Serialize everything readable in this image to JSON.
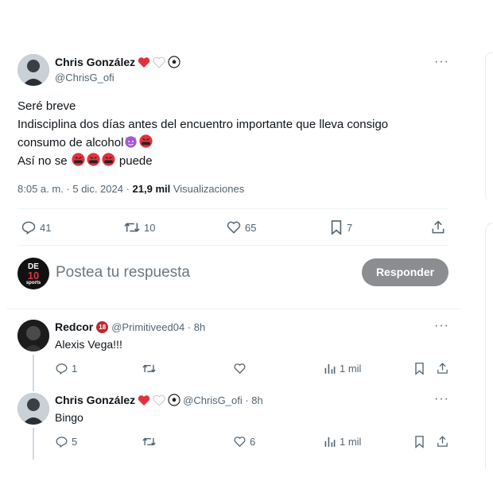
{
  "main_tweet": {
    "author_name": "Chris González",
    "author_handle": "@ChrisG_ofi",
    "lines": [
      "Seré breve",
      "Indisciplina dos días antes del encuentro importante que lleva consigo",
      "consumo de alcohol",
      "Así no se",
      "puede"
    ],
    "timestamp": "8:05 a. m. · 5 dic. 2024 · ",
    "views_count": "21,9 mil",
    "views_label": " Visualizaciones",
    "replies": "41",
    "retweets": "10",
    "likes": "65",
    "bookmarks": "7"
  },
  "compose": {
    "placeholder": "Postea tu respuesta",
    "button": "Responder",
    "avatar_text_top": "DE",
    "avatar_text_num": "10",
    "avatar_text_bottom": "sports"
  },
  "replies": [
    {
      "name": "Redcor",
      "badge": "18",
      "handle": "@Primitiveed04 · 8h",
      "text": "Alexis Vega!!!",
      "replies": "1",
      "likes": "",
      "views": "1 mil"
    },
    {
      "name": "Chris González",
      "handle": "@ChrisG_ofi · 8h",
      "text": "Bingo",
      "replies": "5",
      "likes": "6",
      "views": "1 mil"
    }
  ],
  "colors": {
    "accent_button": "#8b8d90",
    "heart_red": "#f91880",
    "angry_red": "#e0323c",
    "devil_purple": "#a45ad6"
  },
  "icons": [
    "reply-icon",
    "retweet-icon",
    "heart-icon",
    "bookmark-icon",
    "share-icon",
    "views-icon",
    "more-icon",
    "soccer-ball-icon"
  ]
}
